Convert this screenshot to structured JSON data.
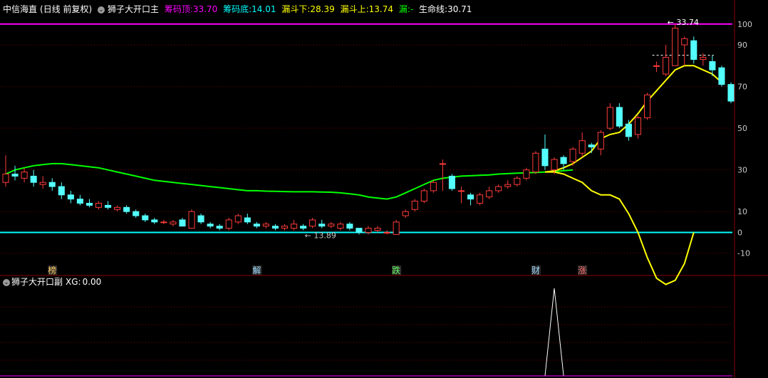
{
  "header": {
    "stock_name": "中信海直",
    "period": "(日线 前复权)",
    "indicator_name": "狮子大开口主",
    "chip_top_label": "筹码顶:",
    "chip_top_value": "33.70",
    "chip_bottom_label": "筹码底:",
    "chip_bottom_value": "14.01",
    "funnel_down_label": "漏斗下:",
    "funnel_down_value": "28.39",
    "funnel_up_label": "漏斗上:",
    "funnel_up_value": "13.74",
    "funnel_label": "漏:",
    "funnel_value": "-",
    "life_line_label": "生命线:",
    "life_line_value": "30.71"
  },
  "colors": {
    "background": "#000000",
    "up_candle": "#ff3b3b",
    "down_candle": "#54ffff",
    "life_line": "#00ff00",
    "yellow_line": "#ffff00",
    "cyan_line": "#00ffff",
    "magenta_line": "#ff00ff",
    "grid": "#7a0000",
    "axis_text": "#c8c8c8",
    "header_white": "#ffffff",
    "header_magenta": "#ff00ff",
    "header_cyan": "#00ffff",
    "header_yellow": "#ffff00"
  },
  "chart_data": [
    {
      "type": "candlestick",
      "title": "狮子大开口主",
      "ylim": [
        -20,
        103
      ],
      "y_ticks": [
        "100",
        "90",
        "70",
        "50",
        "30",
        "10",
        "0",
        "-10"
      ],
      "annotations": {
        "high_label": "33.74",
        "low_label": "13.89"
      },
      "candles": [
        {
          "o": 24,
          "c": 28,
          "h": 37,
          "l": 22
        },
        {
          "o": 28,
          "c": 27,
          "h": 32,
          "l": 25
        },
        {
          "o": 26,
          "c": 29,
          "h": 31,
          "l": 24
        },
        {
          "o": 27,
          "c": 24,
          "h": 30,
          "l": 22
        },
        {
          "o": 23,
          "c": 24,
          "h": 27,
          "l": 21
        },
        {
          "o": 24,
          "c": 22,
          "h": 26,
          "l": 20
        },
        {
          "o": 22,
          "c": 18,
          "h": 24,
          "l": 16
        },
        {
          "o": 18,
          "c": 16,
          "h": 20,
          "l": 14
        },
        {
          "o": 16,
          "c": 14,
          "h": 18,
          "l": 13
        },
        {
          "o": 14,
          "c": 13,
          "h": 16,
          "l": 12
        },
        {
          "o": 12,
          "c": 14,
          "h": 15,
          "l": 11
        },
        {
          "o": 13,
          "c": 12,
          "h": 15,
          "l": 11
        },
        {
          "o": 11,
          "c": 12,
          "h": 13,
          "l": 10
        },
        {
          "o": 12,
          "c": 10,
          "h": 13,
          "l": 9
        },
        {
          "o": 10,
          "c": 8,
          "h": 11,
          "l": 7
        },
        {
          "o": 8,
          "c": 6,
          "h": 9,
          "l": 5
        },
        {
          "o": 6,
          "c": 5,
          "h": 7,
          "l": 4
        },
        {
          "o": 5,
          "c": 5,
          "h": 6,
          "l": 4
        },
        {
          "o": 4,
          "c": 5,
          "h": 6,
          "l": 3
        },
        {
          "o": 6,
          "c": 3,
          "h": 7,
          "l": 3
        },
        {
          "o": 2,
          "c": 10,
          "h": 11,
          "l": 2
        },
        {
          "o": 8,
          "c": 5,
          "h": 9,
          "l": 4
        },
        {
          "o": 4,
          "c": 3,
          "h": 5,
          "l": 2
        },
        {
          "o": 3,
          "c": 2,
          "h": 4,
          "l": 1
        },
        {
          "o": 2,
          "c": 6,
          "h": 7,
          "l": 1
        },
        {
          "o": 5,
          "c": 8,
          "h": 9,
          "l": 4
        },
        {
          "o": 7,
          "c": 5,
          "h": 9,
          "l": 4
        },
        {
          "o": 4,
          "c": 3,
          "h": 5,
          "l": 2
        },
        {
          "o": 3,
          "c": 4,
          "h": 5,
          "l": 2
        },
        {
          "o": 3,
          "c": 2,
          "h": 4,
          "l": 1
        },
        {
          "o": 2,
          "c": 3,
          "h": 4,
          "l": 1
        },
        {
          "o": 2,
          "c": 4,
          "h": 6,
          "l": 1
        },
        {
          "o": 3,
          "c": 2,
          "h": 4,
          "l": 1
        },
        {
          "o": 3,
          "c": 6,
          "h": 7,
          "l": 2
        },
        {
          "o": 4,
          "c": 3,
          "h": 6,
          "l": 2
        },
        {
          "o": 3,
          "c": 4,
          "h": 5,
          "l": 2
        },
        {
          "o": 2,
          "c": 4,
          "h": 5,
          "l": 1
        },
        {
          "o": 4,
          "c": 2,
          "h": 5,
          "l": 1
        },
        {
          "o": 2,
          "c": 0,
          "h": 2,
          "l": -1
        },
        {
          "o": 0,
          "c": 2,
          "h": 3,
          "l": -1
        },
        {
          "o": 1,
          "c": 2,
          "h": 3,
          "l": 0
        },
        {
          "o": 0,
          "c": 0,
          "h": 1,
          "l": -1
        },
        {
          "o": -1,
          "c": 5,
          "h": 6,
          "l": -1
        },
        {
          "o": 8,
          "c": 10,
          "h": 11,
          "l": 7
        },
        {
          "o": 11,
          "c": 15,
          "h": 16,
          "l": 10
        },
        {
          "o": 15,
          "c": 20,
          "h": 21,
          "l": 14
        },
        {
          "o": 20,
          "c": 24,
          "h": 25,
          "l": 19
        },
        {
          "o": 33,
          "c": 33,
          "h": 35,
          "l": 20
        },
        {
          "o": 27,
          "c": 21,
          "h": 28,
          "l": 20
        },
        {
          "o": 20,
          "c": 20,
          "h": 22,
          "l": 14
        },
        {
          "o": 18,
          "c": 16,
          "h": 19,
          "l": 13
        },
        {
          "o": 14,
          "c": 18,
          "h": 19,
          "l": 13
        },
        {
          "o": 17,
          "c": 20,
          "h": 22,
          "l": 16
        },
        {
          "o": 20,
          "c": 22,
          "h": 23,
          "l": 19
        },
        {
          "o": 22,
          "c": 23,
          "h": 25,
          "l": 21
        },
        {
          "o": 23,
          "c": 26,
          "h": 27,
          "l": 22
        },
        {
          "o": 26,
          "c": 30,
          "h": 31,
          "l": 25
        },
        {
          "o": 29,
          "c": 38,
          "h": 39,
          "l": 28
        },
        {
          "o": 40,
          "c": 32,
          "h": 47,
          "l": 30
        },
        {
          "o": 30,
          "c": 35,
          "h": 36,
          "l": 28
        },
        {
          "o": 36,
          "c": 33,
          "h": 37,
          "l": 30
        },
        {
          "o": 34,
          "c": 40,
          "h": 41,
          "l": 32
        },
        {
          "o": 38,
          "c": 44,
          "h": 48,
          "l": 36
        },
        {
          "o": 42,
          "c": 41,
          "h": 43,
          "l": 38
        },
        {
          "o": 40,
          "c": 48,
          "h": 49,
          "l": 37
        },
        {
          "o": 50,
          "c": 60,
          "h": 62,
          "l": 49
        },
        {
          "o": 60,
          "c": 51,
          "h": 62,
          "l": 50
        },
        {
          "o": 52,
          "c": 46,
          "h": 54,
          "l": 44
        },
        {
          "o": 47,
          "c": 55,
          "h": 56,
          "l": 45
        },
        {
          "o": 55,
          "c": 66,
          "h": 67,
          "l": 54
        },
        {
          "o": 80,
          "c": 80,
          "h": 82,
          "l": 77
        },
        {
          "o": 76,
          "c": 84,
          "h": 90,
          "l": 75
        },
        {
          "o": 80,
          "c": 98,
          "h": 100,
          "l": 80
        },
        {
          "o": 90,
          "c": 93,
          "h": 94,
          "l": 80
        },
        {
          "o": 92,
          "c": 83,
          "h": 94,
          "l": 81
        },
        {
          "o": 83,
          "c": 84,
          "h": 86,
          "l": 80
        },
        {
          "o": 82,
          "c": 78,
          "h": 85,
          "l": 75
        },
        {
          "o": 79,
          "c": 71,
          "h": 80,
          "l": 70
        },
        {
          "o": 71,
          "c": 63,
          "h": 72,
          "l": 62
        }
      ],
      "series": [
        {
          "name": "生命线",
          "values": [
            28,
            30,
            31,
            32,
            32.5,
            33,
            33,
            32.5,
            32,
            31.5,
            31,
            30,
            29,
            28,
            27,
            26,
            25,
            24.5,
            24,
            23.5,
            23,
            22.5,
            22,
            21.5,
            21,
            20.5,
            20,
            20,
            19.8,
            19.7,
            19.6,
            19.5,
            19.5,
            19.5,
            19.4,
            19.3,
            19,
            18.5,
            18,
            17,
            16.5,
            16,
            17,
            19,
            21,
            23,
            25,
            26,
            26.5,
            27,
            27.2,
            27.4,
            27.6,
            28,
            28.2,
            28.4,
            28.6,
            28.8,
            29,
            29.2,
            29.6,
            30,
            null,
            null,
            null,
            null,
            null,
            null,
            null,
            null,
            null,
            null,
            null,
            null,
            null,
            null,
            null,
            null,
            null
          ]
        },
        {
          "name": "",
          "values": [
            null,
            null,
            null,
            null,
            null,
            null,
            null,
            null,
            null,
            null,
            null,
            null,
            null,
            null,
            null,
            null,
            null,
            null,
            null,
            null,
            null,
            null,
            null,
            null,
            null,
            null,
            null,
            null,
            null,
            null,
            null,
            null,
            null,
            null,
            null,
            null,
            null,
            null,
            null,
            null,
            null,
            null,
            null,
            null,
            null,
            null,
            null,
            null,
            null,
            null,
            null,
            null,
            null,
            null,
            null,
            null,
            null,
            null,
            29,
            29.5,
            31,
            33,
            36,
            39,
            45,
            47,
            48,
            52,
            57,
            63,
            68,
            73,
            78,
            80,
            80,
            78,
            76,
            72
          ]
        },
        {
          "name": "",
          "values": [
            null,
            null,
            null,
            null,
            null,
            null,
            null,
            null,
            null,
            null,
            null,
            null,
            null,
            null,
            null,
            null,
            null,
            null,
            null,
            null,
            null,
            null,
            null,
            null,
            null,
            null,
            null,
            null,
            null,
            null,
            null,
            null,
            null,
            null,
            null,
            null,
            null,
            null,
            null,
            null,
            null,
            null,
            null,
            null,
            null,
            null,
            null,
            null,
            null,
            null,
            null,
            null,
            null,
            null,
            null,
            null,
            null,
            null,
            29,
            29,
            28,
            26,
            24,
            20,
            18,
            18,
            16,
            9,
            0,
            -12,
            -22,
            -25,
            -23,
            -15,
            0
          ]
        },
        {
          "name": "",
          "values": "const 0"
        }
      ]
    },
    {
      "type": "line",
      "title": "狮子大开口副",
      "series": [
        {
          "name": "XG",
          "values": [
            0,
            0,
            0,
            0,
            0,
            0,
            0,
            0,
            0,
            0,
            0,
            0,
            0,
            0,
            0,
            0,
            0,
            0,
            0,
            0,
            0,
            0,
            0,
            0,
            0,
            0,
            0,
            0,
            0,
            0,
            0,
            0,
            0,
            0,
            0,
            0,
            0,
            0,
            0,
            0,
            0,
            0,
            0,
            0,
            0,
            0,
            0,
            0,
            0,
            0,
            0,
            0,
            0,
            0,
            0,
            0,
            0,
            0,
            0,
            1,
            0,
            0,
            0,
            0,
            0,
            0,
            0,
            0,
            0,
            0,
            0,
            0,
            0,
            0,
            0,
            0,
            0,
            0
          ]
        }
      ]
    }
  ],
  "markers": [
    {
      "text": "榜",
      "color": "#ffcc66",
      "index": 5
    },
    {
      "text": "解",
      "color": "#9fdcff",
      "index": 27
    },
    {
      "text": "跌",
      "color": "#66ff66",
      "index": 42
    },
    {
      "text": "财",
      "color": "#9fdcff",
      "index": 57
    },
    {
      "text": "涨",
      "color": "#ff6666",
      "index": 62
    }
  ],
  "sub_header": {
    "indicator_name": "狮子大开口副",
    "xg_label": "XG:",
    "xg_value": "0.00"
  }
}
